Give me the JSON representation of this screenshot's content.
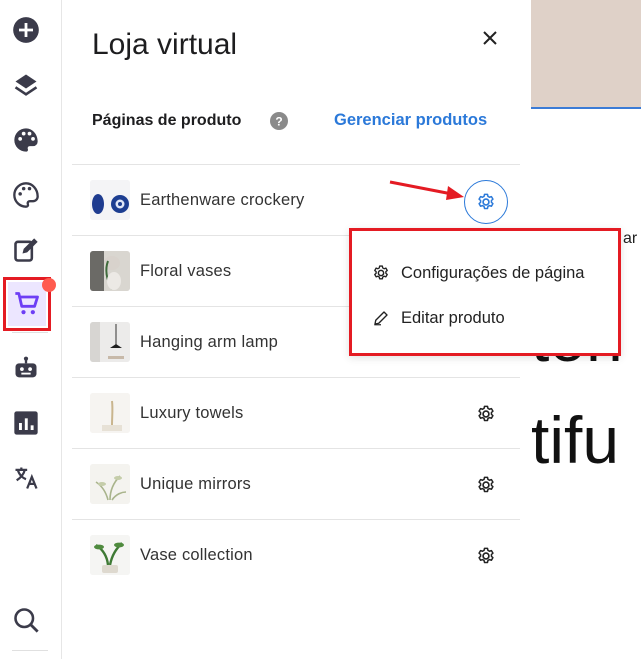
{
  "panel": {
    "title": "Loja virtual",
    "section_label": "Páginas de produto",
    "manage_link": "Gerenciar produtos"
  },
  "products": [
    {
      "label": "Earthenware crockery"
    },
    {
      "label": "Floral vases"
    },
    {
      "label": "Hanging arm lamp"
    },
    {
      "label": "Luxury towels"
    },
    {
      "label": "Unique mirrors"
    },
    {
      "label": "Vase collection"
    }
  ],
  "context_menu": {
    "items": [
      {
        "label": "Configurações de página",
        "icon": "gear-icon"
      },
      {
        "label": "Editar produto",
        "icon": "pencil-icon"
      }
    ]
  },
  "canvas": {
    "small_text": "ar",
    "big_text_1": "ton",
    "big_text_2": "tifu"
  },
  "rail": {
    "icons": [
      "add-icon",
      "layers-icon",
      "palette-icon",
      "theme-palette-icon",
      "edit-icon",
      "cart-icon",
      "robot-icon",
      "analytics-icon",
      "translate-icon",
      "search-icon"
    ]
  },
  "colors": {
    "accent": "#2b79d9",
    "highlight": "#e41b23",
    "canvas_bg": "#dfd1c8",
    "selected_bg": "#ece6ff",
    "badge": "#ff5b4f"
  }
}
